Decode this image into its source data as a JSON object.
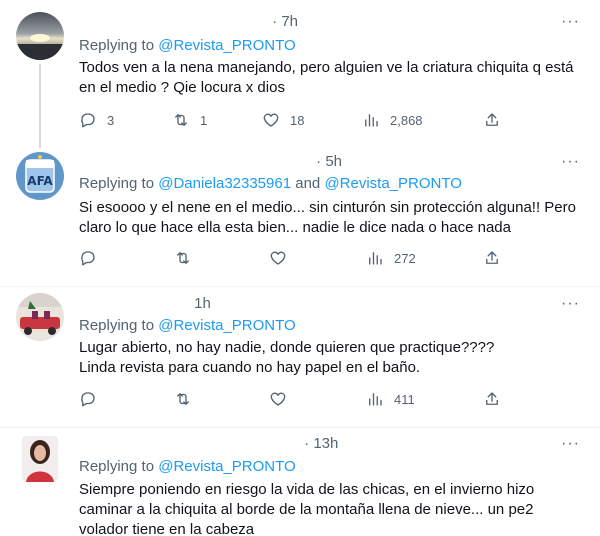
{
  "tweets": [
    {
      "time": "7h",
      "replying_prefix": "Replying to ",
      "mentions": [
        "@Revista_PRONTO"
      ],
      "mention_joiner": "",
      "text": "Todos ven a la nena manejando, pero alguien ve la criatura chiquita q está en el medio ? Qie locura x dios",
      "replies": "3",
      "retweets": "1",
      "likes": "18",
      "views": "2,868"
    },
    {
      "time": "5h",
      "replying_prefix": "Replying to ",
      "mentions": [
        "@Daniela32335961",
        "@Revista_PRONTO"
      ],
      "mention_joiner": " and ",
      "text": "Si esoooo y el nene en el medio... sin cinturón sin protección alguna!! Pero claro lo que hace ella esta bien... nadie le dice nada o hace nada",
      "replies": "",
      "retweets": "",
      "likes": "",
      "views": "272"
    },
    {
      "time": "1h",
      "replying_prefix": "Replying to ",
      "mentions": [
        "@Revista_PRONTO"
      ],
      "mention_joiner": "",
      "text": "Lugar abierto, no hay nadie, donde quieren que practique????\nLinda revista para cuando no hay papel en el baño.",
      "replies": "",
      "retweets": "",
      "likes": "",
      "views": "411"
    },
    {
      "time": "13h",
      "replying_prefix": "Replying to ",
      "mentions": [
        "@Revista_PRONTO"
      ],
      "mention_joiner": "",
      "text": "Siempre poniendo en riesgo la vida de las chicas, en el invierno hizo caminar a la chiquita al borde de la montaña llena de nieve... un pe2 volador tiene en la cabeza"
    }
  ],
  "more_label": "···",
  "dot": "·",
  "icons": {
    "reply": "reply-icon",
    "retweet": "retweet-icon",
    "like": "heart-icon",
    "views": "views-icon",
    "share": "share-icon",
    "more": "more-icon"
  },
  "colors": {
    "accent": "#1d9bf0",
    "secondary_text": "#536471",
    "primary_text": "#0f1419"
  }
}
